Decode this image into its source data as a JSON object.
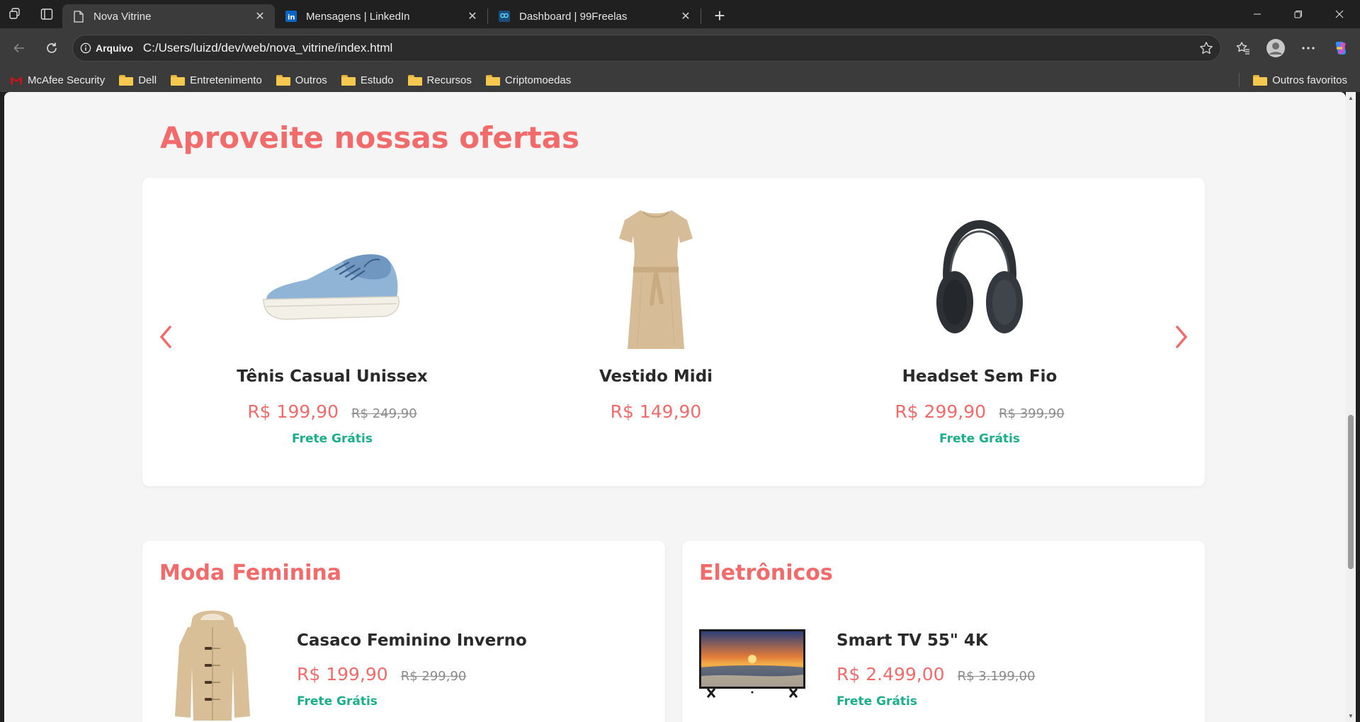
{
  "browser": {
    "tabs": [
      {
        "title": "Nova Vitrine",
        "active": true,
        "icon": "page-icon"
      },
      {
        "title": "Mensagens | LinkedIn",
        "active": false,
        "icon": "linkedin-icon"
      },
      {
        "title": "Dashboard | 99Freelas",
        "active": false,
        "icon": "99freelas-icon"
      }
    ],
    "address": {
      "security_label": "Arquivo",
      "url": "C:/Users/luizd/dev/web/nova_vitrine/index.html"
    },
    "bookmarks": [
      "McAfee Security",
      "Dell",
      "Entretenimento",
      "Outros",
      "Estudo",
      "Recursos",
      "Criptomoedas"
    ],
    "other_bookmarks": "Outros favoritos"
  },
  "page": {
    "offers_title": "Aproveite nossas ofertas",
    "carousel": [
      {
        "name": "Tênis Casual Unissex",
        "price": "R$ 199,90",
        "old_price": "R$ 249,90",
        "shipping": "Frete Grátis",
        "image": "sneaker-image"
      },
      {
        "name": "Vestido Midi",
        "price": "R$ 149,90",
        "old_price": "",
        "shipping": "",
        "image": "dress-image"
      },
      {
        "name": "Headset Sem Fio",
        "price": "R$ 299,90",
        "old_price": "R$ 399,90",
        "shipping": "Frete Grátis",
        "image": "headset-image"
      }
    ],
    "categories": [
      {
        "title": "Moda Feminina",
        "product": {
          "name": "Casaco Feminino Inverno",
          "price": "R$ 199,90",
          "old_price": "R$ 299,90",
          "shipping": "Frete Grátis",
          "image": "coat-image"
        }
      },
      {
        "title": "Eletrônicos",
        "product": {
          "name": "Smart TV 55\" 4K",
          "price": "R$ 2.499,00",
          "old_price": "R$ 3.199,00",
          "shipping": "Frete Grátis",
          "image": "tv-image"
        }
      }
    ]
  },
  "colors": {
    "accent": "#f26b6b",
    "shipping": "#1aae8a",
    "page_bg": "#f5f5f5",
    "chrome_bg": "#202020"
  }
}
